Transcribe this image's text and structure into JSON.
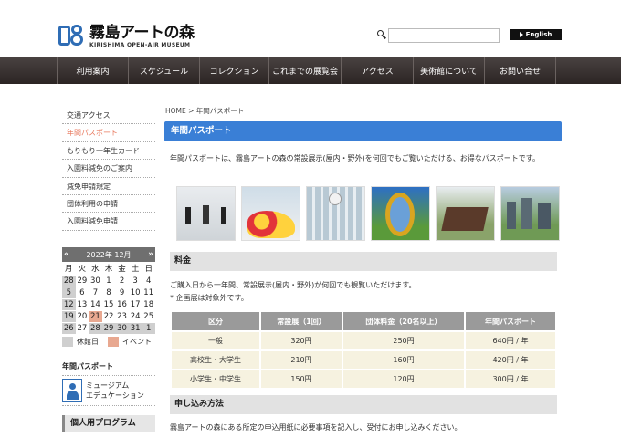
{
  "header": {
    "logo_title": "霧島アートの森",
    "logo_sub": "KIRISHIMA OPEN-AIR MUSEUM",
    "search_placeholder": "",
    "english_label": "English"
  },
  "nav": [
    {
      "label": "利用案内"
    },
    {
      "label": "スケジュール"
    },
    {
      "label": "コレクション"
    },
    {
      "label": "これまでの展覧会"
    },
    {
      "label": "アクセス"
    },
    {
      "label": "美術館について"
    },
    {
      "label": "お問い合せ"
    }
  ],
  "sidebar": {
    "items": [
      {
        "label": "交通アクセス"
      },
      {
        "label": "年間パスポート"
      },
      {
        "label": "もりもり一年生カード"
      },
      {
        "label": "入園料減免のご案内"
      },
      {
        "label": "減免申請規定"
      },
      {
        "label": "団体利用の申請"
      },
      {
        "label": "入園料減免申請"
      }
    ],
    "active_index": 1
  },
  "calendar": {
    "prev": "«",
    "next": "»",
    "month_label": "2022年 12月",
    "weekdays": [
      "月",
      "火",
      "水",
      "木",
      "金",
      "土",
      "日"
    ],
    "cells": [
      {
        "d": "28",
        "s": "gray"
      },
      {
        "d": "29",
        "s": ""
      },
      {
        "d": "30",
        "s": ""
      },
      {
        "d": "1",
        "s": ""
      },
      {
        "d": "2",
        "s": ""
      },
      {
        "d": "3",
        "s": ""
      },
      {
        "d": "4",
        "s": ""
      },
      {
        "d": "5",
        "s": "gray"
      },
      {
        "d": "6",
        "s": ""
      },
      {
        "d": "7",
        "s": ""
      },
      {
        "d": "8",
        "s": ""
      },
      {
        "d": "9",
        "s": ""
      },
      {
        "d": "10",
        "s": ""
      },
      {
        "d": "11",
        "s": ""
      },
      {
        "d": "12",
        "s": "gray"
      },
      {
        "d": "13",
        "s": ""
      },
      {
        "d": "14",
        "s": ""
      },
      {
        "d": "15",
        "s": ""
      },
      {
        "d": "16",
        "s": ""
      },
      {
        "d": "17",
        "s": ""
      },
      {
        "d": "18",
        "s": ""
      },
      {
        "d": "19",
        "s": "gray"
      },
      {
        "d": "20",
        "s": ""
      },
      {
        "d": "21",
        "s": "today"
      },
      {
        "d": "22",
        "s": ""
      },
      {
        "d": "23",
        "s": ""
      },
      {
        "d": "24",
        "s": ""
      },
      {
        "d": "25",
        "s": ""
      },
      {
        "d": "26",
        "s": "gray"
      },
      {
        "d": "27",
        "s": ""
      },
      {
        "d": "28",
        "s": "gray"
      },
      {
        "d": "29",
        "s": "gray"
      },
      {
        "d": "30",
        "s": "gray"
      },
      {
        "d": "31",
        "s": "gray"
      },
      {
        "d": "1",
        "s": "gray"
      }
    ],
    "legend_closed": "休館日",
    "legend_event": "イベント"
  },
  "side_section": {
    "title": "年間パスポート",
    "edu_line1": "ミュージアム",
    "edu_line2": "エデュケーション",
    "personal_program": "個人用プログラム"
  },
  "main": {
    "breadcrumb": "HOME > 年間パスポート",
    "title": "年間パスポート",
    "intro": "年間パスポートは、霧島アートの森の常設展示(屋内・野外)を何回でもご覧いただける、お得なパスポートです。",
    "fee_heading": "料金",
    "fee_line1": "ご購入日から一年間、常設展示(屋内・野外)が何回でも観覧いただけます。",
    "fee_line2": "* 企画展は対象外です。",
    "table_headers": [
      "区分",
      "常設展（1回）",
      "団体料金（20名以上）",
      "年間パスポート"
    ],
    "table_rows": [
      [
        "一般",
        "320円",
        "250円",
        "640円 / 年"
      ],
      [
        "高校生・大学生",
        "210円",
        "160円",
        "420円 / 年"
      ],
      [
        "小学生・中学生",
        "150円",
        "120円",
        "300円 / 年"
      ]
    ],
    "apply_heading": "申し込み方法",
    "apply_text": "霧島アートの森にある所定の申込用紙に必要事項を記入し、受付にお申し込みください。"
  },
  "colors": {
    "accent_blue": "#3a7fd6",
    "nav_bg": "#2c2524",
    "active_link": "#e8795e",
    "calendar_today": "#e8a890"
  }
}
